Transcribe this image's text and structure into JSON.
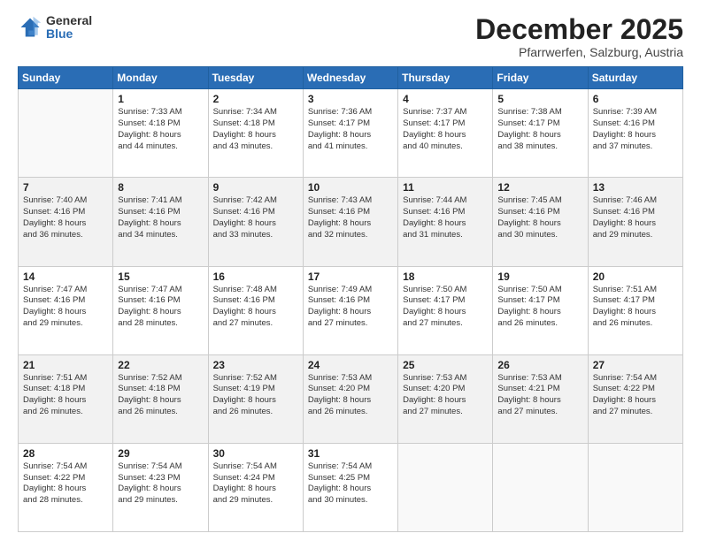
{
  "header": {
    "logo_general": "General",
    "logo_blue": "Blue",
    "month_title": "December 2025",
    "location": "Pfarrwerfen, Salzburg, Austria"
  },
  "weekdays": [
    "Sunday",
    "Monday",
    "Tuesday",
    "Wednesday",
    "Thursday",
    "Friday",
    "Saturday"
  ],
  "weeks": [
    [
      {
        "day": "",
        "info": ""
      },
      {
        "day": "1",
        "info": "Sunrise: 7:33 AM\nSunset: 4:18 PM\nDaylight: 8 hours\nand 44 minutes."
      },
      {
        "day": "2",
        "info": "Sunrise: 7:34 AM\nSunset: 4:18 PM\nDaylight: 8 hours\nand 43 minutes."
      },
      {
        "day": "3",
        "info": "Sunrise: 7:36 AM\nSunset: 4:17 PM\nDaylight: 8 hours\nand 41 minutes."
      },
      {
        "day": "4",
        "info": "Sunrise: 7:37 AM\nSunset: 4:17 PM\nDaylight: 8 hours\nand 40 minutes."
      },
      {
        "day": "5",
        "info": "Sunrise: 7:38 AM\nSunset: 4:17 PM\nDaylight: 8 hours\nand 38 minutes."
      },
      {
        "day": "6",
        "info": "Sunrise: 7:39 AM\nSunset: 4:16 PM\nDaylight: 8 hours\nand 37 minutes."
      }
    ],
    [
      {
        "day": "7",
        "info": "Sunrise: 7:40 AM\nSunset: 4:16 PM\nDaylight: 8 hours\nand 36 minutes."
      },
      {
        "day": "8",
        "info": "Sunrise: 7:41 AM\nSunset: 4:16 PM\nDaylight: 8 hours\nand 34 minutes."
      },
      {
        "day": "9",
        "info": "Sunrise: 7:42 AM\nSunset: 4:16 PM\nDaylight: 8 hours\nand 33 minutes."
      },
      {
        "day": "10",
        "info": "Sunrise: 7:43 AM\nSunset: 4:16 PM\nDaylight: 8 hours\nand 32 minutes."
      },
      {
        "day": "11",
        "info": "Sunrise: 7:44 AM\nSunset: 4:16 PM\nDaylight: 8 hours\nand 31 minutes."
      },
      {
        "day": "12",
        "info": "Sunrise: 7:45 AM\nSunset: 4:16 PM\nDaylight: 8 hours\nand 30 minutes."
      },
      {
        "day": "13",
        "info": "Sunrise: 7:46 AM\nSunset: 4:16 PM\nDaylight: 8 hours\nand 29 minutes."
      }
    ],
    [
      {
        "day": "14",
        "info": "Sunrise: 7:47 AM\nSunset: 4:16 PM\nDaylight: 8 hours\nand 29 minutes."
      },
      {
        "day": "15",
        "info": "Sunrise: 7:47 AM\nSunset: 4:16 PM\nDaylight: 8 hours\nand 28 minutes."
      },
      {
        "day": "16",
        "info": "Sunrise: 7:48 AM\nSunset: 4:16 PM\nDaylight: 8 hours\nand 27 minutes."
      },
      {
        "day": "17",
        "info": "Sunrise: 7:49 AM\nSunset: 4:16 PM\nDaylight: 8 hours\nand 27 minutes."
      },
      {
        "day": "18",
        "info": "Sunrise: 7:50 AM\nSunset: 4:17 PM\nDaylight: 8 hours\nand 27 minutes."
      },
      {
        "day": "19",
        "info": "Sunrise: 7:50 AM\nSunset: 4:17 PM\nDaylight: 8 hours\nand 26 minutes."
      },
      {
        "day": "20",
        "info": "Sunrise: 7:51 AM\nSunset: 4:17 PM\nDaylight: 8 hours\nand 26 minutes."
      }
    ],
    [
      {
        "day": "21",
        "info": "Sunrise: 7:51 AM\nSunset: 4:18 PM\nDaylight: 8 hours\nand 26 minutes."
      },
      {
        "day": "22",
        "info": "Sunrise: 7:52 AM\nSunset: 4:18 PM\nDaylight: 8 hours\nand 26 minutes."
      },
      {
        "day": "23",
        "info": "Sunrise: 7:52 AM\nSunset: 4:19 PM\nDaylight: 8 hours\nand 26 minutes."
      },
      {
        "day": "24",
        "info": "Sunrise: 7:53 AM\nSunset: 4:20 PM\nDaylight: 8 hours\nand 26 minutes."
      },
      {
        "day": "25",
        "info": "Sunrise: 7:53 AM\nSunset: 4:20 PM\nDaylight: 8 hours\nand 27 minutes."
      },
      {
        "day": "26",
        "info": "Sunrise: 7:53 AM\nSunset: 4:21 PM\nDaylight: 8 hours\nand 27 minutes."
      },
      {
        "day": "27",
        "info": "Sunrise: 7:54 AM\nSunset: 4:22 PM\nDaylight: 8 hours\nand 27 minutes."
      }
    ],
    [
      {
        "day": "28",
        "info": "Sunrise: 7:54 AM\nSunset: 4:22 PM\nDaylight: 8 hours\nand 28 minutes."
      },
      {
        "day": "29",
        "info": "Sunrise: 7:54 AM\nSunset: 4:23 PM\nDaylight: 8 hours\nand 29 minutes."
      },
      {
        "day": "30",
        "info": "Sunrise: 7:54 AM\nSunset: 4:24 PM\nDaylight: 8 hours\nand 29 minutes."
      },
      {
        "day": "31",
        "info": "Sunrise: 7:54 AM\nSunset: 4:25 PM\nDaylight: 8 hours\nand 30 minutes."
      },
      {
        "day": "",
        "info": ""
      },
      {
        "day": "",
        "info": ""
      },
      {
        "day": "",
        "info": ""
      }
    ]
  ]
}
